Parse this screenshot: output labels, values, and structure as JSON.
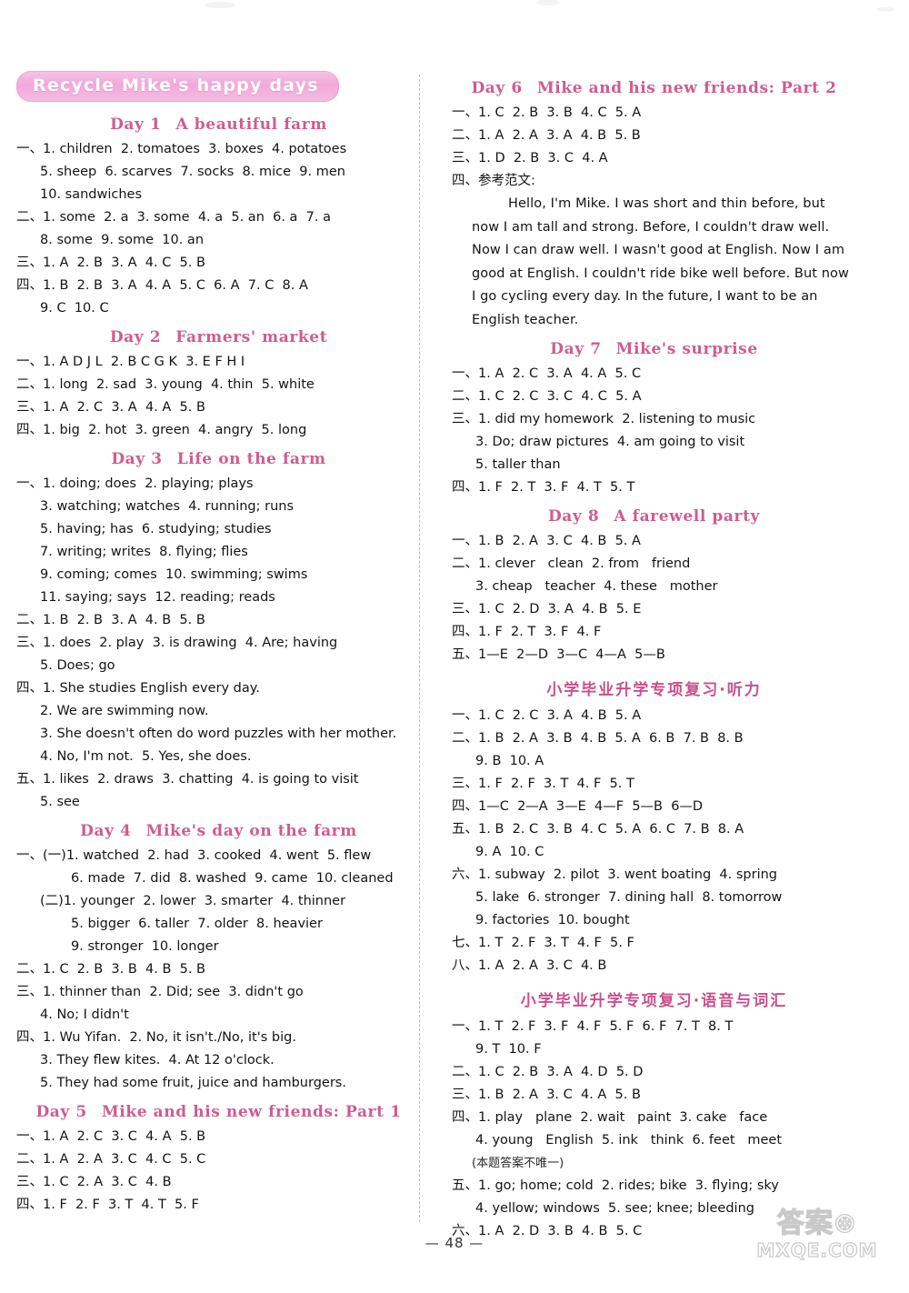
{
  "page": {
    "page_number": "— 48 —",
    "banner_title": "Recycle   Mike's happy days",
    "watermark_cn": "答案⊛",
    "watermark_en": "MXQE.COM"
  },
  "left_column": [
    {
      "kind": "banner",
      "text": "Recycle   Mike's happy days"
    },
    {
      "kind": "day",
      "num": "Day 1",
      "title": "A beautiful farm"
    },
    {
      "kind": "line",
      "indent": 0,
      "text": "一、1. children  2. tomatoes  3. boxes  4. potatoes"
    },
    {
      "kind": "line",
      "indent": 1,
      "text": "5. sheep  6. scarves  7. socks  8. mice  9. men"
    },
    {
      "kind": "line",
      "indent": 1,
      "text": "10. sandwiches"
    },
    {
      "kind": "line",
      "indent": 0,
      "text": "二、1. some  2. a  3. some  4. a  5. an  6. a  7. a"
    },
    {
      "kind": "line",
      "indent": 1,
      "text": "8. some  9. some  10. an"
    },
    {
      "kind": "line",
      "indent": 0,
      "text": "三、1. A  2. B  3. A  4. C  5. B"
    },
    {
      "kind": "line",
      "indent": 0,
      "text": "四、1. B  2. B  3. A  4. A  5. C  6. A  7. C  8. A"
    },
    {
      "kind": "line",
      "indent": 1,
      "text": "9. C  10. C"
    },
    {
      "kind": "day",
      "num": "Day 2",
      "title": "Farmers' market"
    },
    {
      "kind": "line",
      "indent": 0,
      "text": "一、1. A D J L  2. B C G K  3. E F H I"
    },
    {
      "kind": "line",
      "indent": 0,
      "text": "二、1. long  2. sad  3. young  4. thin  5. white"
    },
    {
      "kind": "line",
      "indent": 0,
      "text": "三、1. A  2. C  3. A  4. A  5. B"
    },
    {
      "kind": "line",
      "indent": 0,
      "text": "四、1. big  2. hot  3. green  4. angry  5. long"
    },
    {
      "kind": "day",
      "num": "Day 3",
      "title": "Life on the farm"
    },
    {
      "kind": "line",
      "indent": 0,
      "text": "一、1. doing; does  2. playing; plays"
    },
    {
      "kind": "line",
      "indent": 1,
      "text": "3. watching; watches  4. running; runs"
    },
    {
      "kind": "line",
      "indent": 1,
      "text": "5. having; has  6. studying; studies"
    },
    {
      "kind": "line",
      "indent": 1,
      "text": "7. writing; writes  8. flying; flies"
    },
    {
      "kind": "line",
      "indent": 1,
      "text": "9. coming; comes  10. swimming; swims"
    },
    {
      "kind": "line",
      "indent": 1,
      "text": "11. saying; says  12. reading; reads"
    },
    {
      "kind": "line",
      "indent": 0,
      "text": "二、1. B  2. B  3. A  4. B  5. B"
    },
    {
      "kind": "line",
      "indent": 0,
      "text": "三、1. does  2. play  3. is drawing  4. Are; having"
    },
    {
      "kind": "line",
      "indent": 1,
      "text": "5. Does; go"
    },
    {
      "kind": "line",
      "indent": 0,
      "text": "四、1. She studies English every day."
    },
    {
      "kind": "line",
      "indent": 1,
      "text": "2. We are swimming now."
    },
    {
      "kind": "line",
      "indent": 1,
      "text": "3. She doesn't often do word puzzles with her mother."
    },
    {
      "kind": "line",
      "indent": 1,
      "text": "4. No, I'm not.  5. Yes, she does."
    },
    {
      "kind": "line",
      "indent": 0,
      "text": "五、1. likes  2. draws  3. chatting  4. is going to visit"
    },
    {
      "kind": "line",
      "indent": 1,
      "text": "5. see"
    },
    {
      "kind": "day",
      "num": "Day 4",
      "title": "Mike's day on the farm"
    },
    {
      "kind": "line",
      "indent": 0,
      "text": "一、(一)1. watched  2. had  3. cooked  4. went  5. flew"
    },
    {
      "kind": "line",
      "indent": 2,
      "text": "6. made  7. did  8. washed  9. came  10. cleaned"
    },
    {
      "kind": "line",
      "indent": 1,
      "text": "(二)1. younger  2. lower  3. smarter  4. thinner"
    },
    {
      "kind": "line",
      "indent": 2,
      "text": "5. bigger  6. taller  7. older  8. heavier"
    },
    {
      "kind": "line",
      "indent": 2,
      "text": "9. stronger  10. longer"
    },
    {
      "kind": "line",
      "indent": 0,
      "text": "二、1. C  2. B  3. B  4. B  5. B"
    },
    {
      "kind": "line",
      "indent": 0,
      "text": "三、1. thinner than  2. Did; see  3. didn't go"
    },
    {
      "kind": "line",
      "indent": 1,
      "text": "4. No; I didn't"
    },
    {
      "kind": "line",
      "indent": 0,
      "text": "四、1. Wu Yifan.  2. No, it isn't./No, it's big."
    },
    {
      "kind": "line",
      "indent": 1,
      "text": "3. They flew kites.  4. At 12 o'clock."
    },
    {
      "kind": "line",
      "indent": 1,
      "text": "5. They had some fruit, juice and hamburgers."
    },
    {
      "kind": "day",
      "num": "Day 5",
      "title": "Mike and his new friends: Part 1"
    },
    {
      "kind": "line",
      "indent": 0,
      "text": "一、1. A  2. C  3. C  4. A  5. B"
    },
    {
      "kind": "line",
      "indent": 0,
      "text": "二、1. A  2. A  3. C  4. C  5. C"
    },
    {
      "kind": "line",
      "indent": 0,
      "text": "三、1. C  2. A  3. C  4. B"
    },
    {
      "kind": "line",
      "indent": 0,
      "text": "四、1. F  2. F  3. T  4. T  5. F"
    }
  ],
  "right_column": [
    {
      "kind": "day",
      "num": "Day 6",
      "title": "Mike and his new friends: Part 2"
    },
    {
      "kind": "line",
      "indent": 0,
      "text": "一、1. C  2. B  3. B  4. C  5. A"
    },
    {
      "kind": "line",
      "indent": 0,
      "text": "二、1. A  2. A  3. A  4. B  5. B"
    },
    {
      "kind": "line",
      "indent": 0,
      "text": "三、1. D  2. B  3. C  4. A"
    },
    {
      "kind": "line",
      "indent": 0,
      "text": "四、参考范文:"
    },
    {
      "kind": "essay",
      "first": true,
      "text": "Hello, I'm Mike. I was short and thin before, but now I am tall and strong. Before, I couldn't draw well. Now I can draw well. I wasn't good at English. Now I am good at English. I couldn't ride bike well before. But now I go cycling every day. In the future, I want to be an English teacher."
    },
    {
      "kind": "day",
      "num": "Day 7",
      "title": "Mike's surprise"
    },
    {
      "kind": "line",
      "indent": 0,
      "text": "一、1. A  2. C  3. A  4. A  5. C"
    },
    {
      "kind": "line",
      "indent": 0,
      "text": "二、1. C  2. C  3. C  4. C  5. A"
    },
    {
      "kind": "line",
      "indent": 0,
      "text": "三、1. did my homework  2. listening to music"
    },
    {
      "kind": "line",
      "indent": 1,
      "text": "3. Do; draw pictures  4. am going to visit"
    },
    {
      "kind": "line",
      "indent": 1,
      "text": "5. taller than"
    },
    {
      "kind": "line",
      "indent": 0,
      "text": "四、1. F  2. T  3. F  4. T  5. T"
    },
    {
      "kind": "day",
      "num": "Day 8",
      "title": "A farewell party"
    },
    {
      "kind": "line",
      "indent": 0,
      "text": "一、1. B  2. A  3. C  4. B  5. A"
    },
    {
      "kind": "line",
      "indent": 0,
      "text": "二、1. clever   clean  2. from   friend"
    },
    {
      "kind": "line",
      "indent": 1,
      "text": "3. cheap   teacher  4. these   mother"
    },
    {
      "kind": "line",
      "indent": 0,
      "text": "三、1. C  2. D  3. A  4. B  5. E"
    },
    {
      "kind": "line",
      "indent": 0,
      "text": "四、1. F  2. T  3. F  4. F"
    },
    {
      "kind": "line",
      "indent": 0,
      "text": "五、1—E  2—D  3—C  4—A  5—B"
    },
    {
      "kind": "cn",
      "text": "小学毕业升学专项复习·听力"
    },
    {
      "kind": "line",
      "indent": 0,
      "text": "一、1. C  2. C  3. A  4. B  5. A"
    },
    {
      "kind": "line",
      "indent": 0,
      "text": "二、1. B  2. A  3. B  4. B  5. A  6. B  7. B  8. B"
    },
    {
      "kind": "line",
      "indent": 1,
      "text": "9. B  10. A"
    },
    {
      "kind": "line",
      "indent": 0,
      "text": "三、1. F  2. F  3. T  4. F  5. T"
    },
    {
      "kind": "line",
      "indent": 0,
      "text": "四、1—C  2—A  3—E  4—F  5—B  6—D"
    },
    {
      "kind": "line",
      "indent": 0,
      "text": "五、1. B  2. C  3. B  4. C  5. A  6. C  7. B  8. A"
    },
    {
      "kind": "line",
      "indent": 1,
      "text": "9. A  10. C"
    },
    {
      "kind": "line",
      "indent": 0,
      "text": "六、1. subway  2. pilot  3. went boating  4. spring"
    },
    {
      "kind": "line",
      "indent": 1,
      "text": "5. lake  6. stronger  7. dining hall  8. tomorrow"
    },
    {
      "kind": "line",
      "indent": 1,
      "text": "9. factories  10. bought"
    },
    {
      "kind": "line",
      "indent": 0,
      "text": "七、1. T  2. F  3. T  4. F  5. F"
    },
    {
      "kind": "line",
      "indent": 0,
      "text": "八、1. A  2. A  3. C  4. B"
    },
    {
      "kind": "cn",
      "text": "小学毕业升学专项复习·语音与词汇"
    },
    {
      "kind": "line",
      "indent": 0,
      "text": "一、1. T  2. F  3. F  4. F  5. F  6. F  7. T  8. T"
    },
    {
      "kind": "line",
      "indent": 1,
      "text": "9. T  10. F"
    },
    {
      "kind": "line",
      "indent": 0,
      "text": "二、1. C  2. B  3. A  4. D  5. D"
    },
    {
      "kind": "line",
      "indent": 0,
      "text": "三、1. B  2. A  3. C  4. A  5. B"
    },
    {
      "kind": "line",
      "indent": 0,
      "text": "四、1. play   plane  2. wait   paint  3. cake   face"
    },
    {
      "kind": "line",
      "indent": 1,
      "text": "4. young   English  5. ink   think  6. feet   meet"
    },
    {
      "kind": "note",
      "text": "(本题答案不唯一)"
    },
    {
      "kind": "line",
      "indent": 0,
      "text": "五、1. go; home; cold  2. rides; bike  3. flying; sky"
    },
    {
      "kind": "line",
      "indent": 1,
      "text": "4. yellow; windows  5. see; knee; bleeding"
    },
    {
      "kind": "line",
      "indent": 0,
      "text": "六、1. A  2. D  3. B  4. B  5. C"
    }
  ]
}
